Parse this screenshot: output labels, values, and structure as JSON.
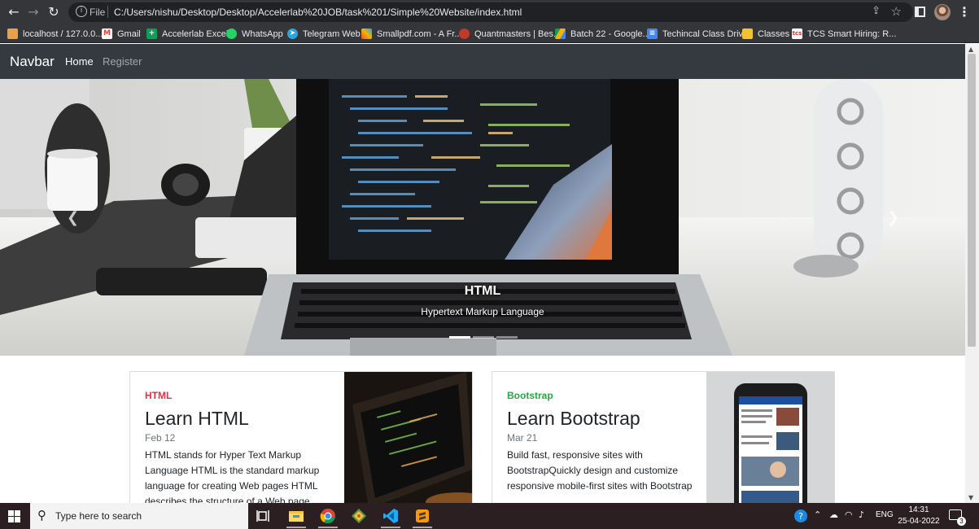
{
  "browser": {
    "omnibox": {
      "scheme_label": "File",
      "url": "C:/Users/nishu/Desktop/Desktop/Accelerlab%20JOB/task%201/Simple%20Website/index.html"
    },
    "bookmarks": [
      {
        "label": "localhost / 127.0.0....",
        "icon": "phpmyadmin-icon",
        "color": "#e8a04a"
      },
      {
        "label": "Gmail",
        "icon": "gmail-icon",
        "color": "#ea4335"
      },
      {
        "label": "Accelerlab Excel",
        "icon": "sheets-icon",
        "color": "#0f9d58"
      },
      {
        "label": "WhatsApp",
        "icon": "whatsapp-icon",
        "color": "#25d366"
      },
      {
        "label": "Telegram Web",
        "icon": "telegram-icon",
        "color": "#2aa3de"
      },
      {
        "label": "Smallpdf.com - A Fr...",
        "icon": "smallpdf-icon",
        "color": "#e84c3d"
      },
      {
        "label": "Quantmasters | Bes...",
        "icon": "quantmasters-icon",
        "color": "#c0392b"
      },
      {
        "label": "Batch 22 - Google...",
        "icon": "drive-icon",
        "color": "#f4b400"
      },
      {
        "label": "Techincal Class Drive",
        "icon": "docs-icon",
        "color": "#4285f4"
      },
      {
        "label": "Classes",
        "icon": "classroom-icon",
        "color": "#f1c232"
      },
      {
        "label": "TCS Smart Hiring: R...",
        "icon": "tcs-icon",
        "color": "#d93025"
      }
    ]
  },
  "site": {
    "navbar": {
      "brand": "Navbar",
      "links": [
        {
          "label": "Home",
          "active": true
        },
        {
          "label": "Register",
          "active": false
        }
      ]
    },
    "carousel": {
      "slide_title": "HTML",
      "slide_caption": "Hypertext Markup Language",
      "slide_count": 3,
      "active_slide": 1
    },
    "cards": [
      {
        "category": "HTML",
        "category_color": "#dc3545",
        "title": "Learn HTML",
        "date": "Feb 12",
        "text": "HTML stands for Hyper Text Markup Language HTML is the standard markup language for creating Web pages HTML describes the structure of a Web page"
      },
      {
        "category": "Bootstrap",
        "category_color": "#28a745",
        "title": "Learn Bootstrap",
        "date": "Mar 21",
        "text": "Build fast, responsive sites with BootstrapQuickly design and customize responsive mobile-first sites with Bootstrap"
      }
    ]
  },
  "taskbar": {
    "search_placeholder": "Type here to search",
    "language": "ENG",
    "time": "14:31",
    "date": "25-04-2022",
    "notification_count": "3",
    "apps": [
      "task-view-icon",
      "file-explorer-icon",
      "chrome-icon",
      "git-icon",
      "vscode-icon",
      "sublime-text-icon"
    ]
  }
}
